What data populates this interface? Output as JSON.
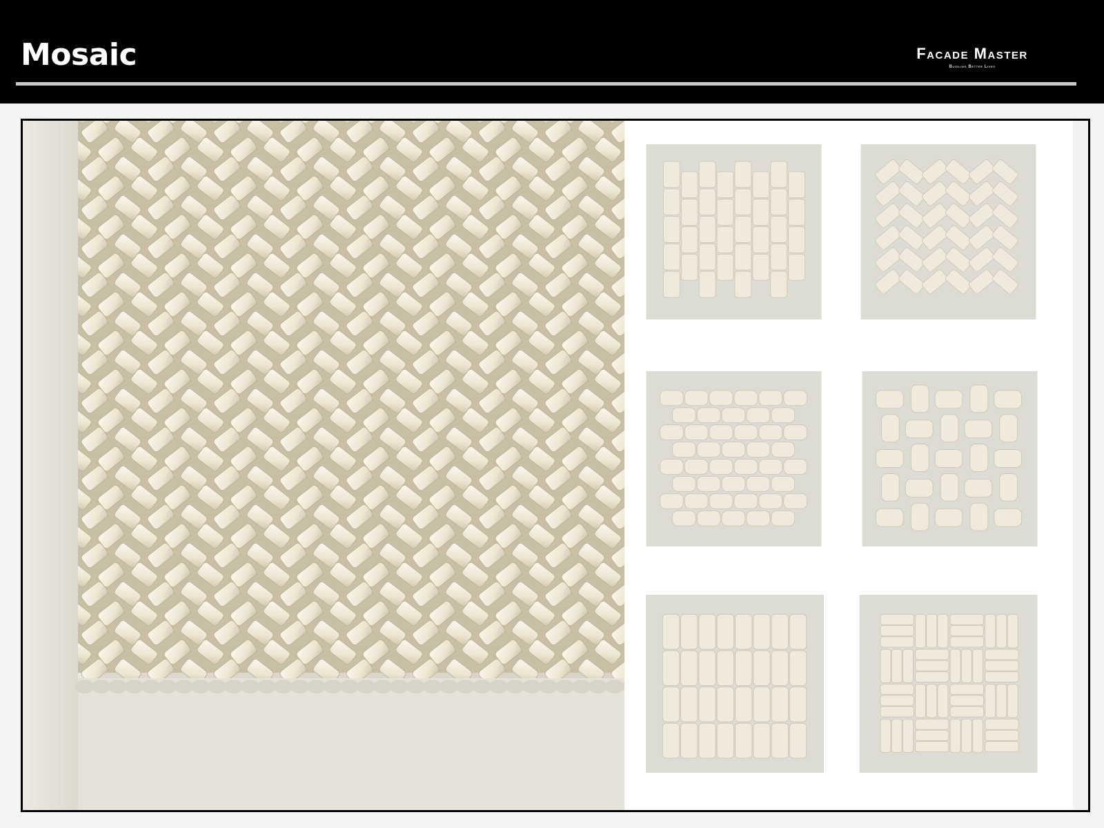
{
  "header": {
    "title": "Mosaic",
    "brand_name": "Facade Master",
    "brand_tagline": "Buidling Better Lives"
  },
  "colors": {
    "header_bg": "#000000",
    "title_text": "#ffffff",
    "rule": "#c9c9c9",
    "tile": "#efeadb",
    "photo_bg": "#e6e4de",
    "thumb_bg": "#dcdcd4"
  },
  "main_image": {
    "subject": "herringbone-woven ceramic mosaic wall panel",
    "icon": "mosaic-photo"
  },
  "thumbnails": [
    {
      "pattern": "vertical-weave"
    },
    {
      "pattern": "chevron-weave"
    },
    {
      "pattern": "brick-arch"
    },
    {
      "pattern": "basket-weave"
    },
    {
      "pattern": "grid-arch"
    },
    {
      "pattern": "checker-weave"
    }
  ]
}
